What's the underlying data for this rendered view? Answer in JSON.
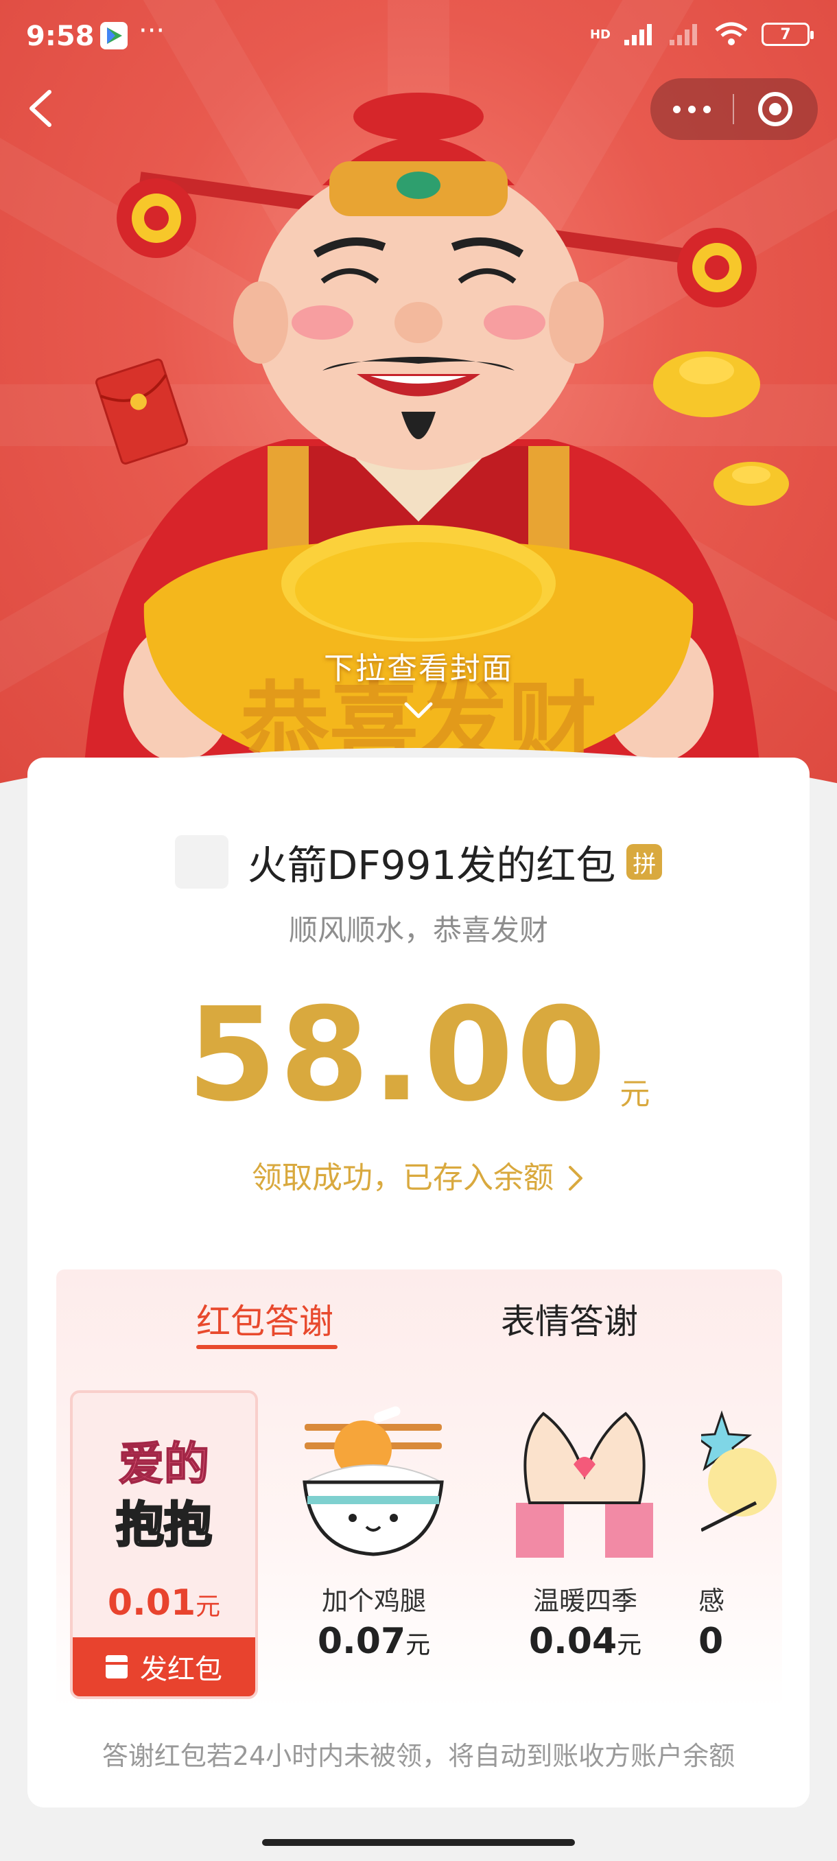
{
  "status_bar": {
    "time": "9:58",
    "more": "···",
    "network": "HD",
    "battery": "7"
  },
  "header": {
    "back_icon": "chevron-left-icon",
    "menu_icon": "more-dots-icon",
    "close_icon": "target-circle-icon",
    "cover_hint": "下拉查看封面",
    "cover_hint_icon": "chevron-down-icon",
    "ingot_text": "恭喜发财"
  },
  "packet": {
    "sender": "火箭DF991发的红包",
    "badge": "拼",
    "blessing": "顺风顺水，恭喜发财",
    "amount": "58.00",
    "unit": "元",
    "received_text": "领取成功，已存入余额",
    "received_chevron": "›"
  },
  "thanks": {
    "tabs": [
      "红包答谢",
      "表情答谢"
    ],
    "active_tab": 0,
    "gifts": [
      {
        "sticker_text_1": "爱的",
        "sticker_text_2": "抱抱",
        "price": "0.01",
        "unit": "元",
        "action": "发红包",
        "selected": true
      },
      {
        "name": "加个鸡腿",
        "price": "0.07",
        "unit": "元",
        "icon": "chicken-leg-rice-bowl-icon"
      },
      {
        "name": "温暖四季",
        "price": "0.04",
        "unit": "元",
        "icon": "heart-hands-icon"
      },
      {
        "name": "感",
        "price": "0",
        "icon": "star-moon-icon"
      }
    ],
    "footnote": "答谢红包若24小时内未被领，将自动到账收方账户余额"
  },
  "colors": {
    "gold": "#d9a93e",
    "red": "#e8432e",
    "cover_red": "#e85a4f"
  }
}
